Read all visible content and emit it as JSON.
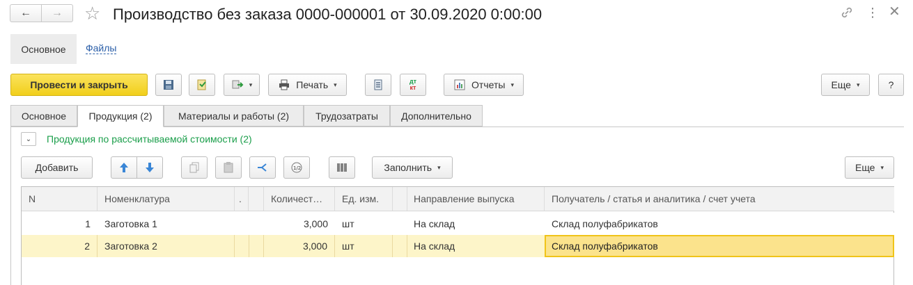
{
  "window": {
    "title": "Производство без заказа 0000-000001 от 30.09.2020 0:00:00"
  },
  "nav_tabs": [
    {
      "label": "Основное"
    },
    {
      "label": "Файлы"
    }
  ],
  "toolbar": {
    "post_close_label": "Провести и закрыть",
    "print_label": "Печать",
    "reports_label": "Отчеты",
    "more_label": "Еще",
    "help_label": "?",
    "dtkt_top": "дт",
    "dtkt_bottom": "кт"
  },
  "tabs": [
    {
      "label": "Основное"
    },
    {
      "label": "Продукция (2)"
    },
    {
      "label": "Материалы и работы (2)"
    },
    {
      "label": "Трудозатраты"
    },
    {
      "label": "Дополнительно"
    }
  ],
  "section": {
    "title": "Продукция по рассчитываемой стоимости (2)"
  },
  "table_toolbar": {
    "add_label": "Добавить",
    "fill_label": "Заполнить",
    "more_label": "Еще"
  },
  "table": {
    "columns": [
      "N",
      "Номенклатура",
      ".",
      "Количест…",
      "Ед. изм.",
      "Направление выпуска",
      "Получатель / статья и аналитика / счет учета"
    ],
    "rows": [
      {
        "n": "1",
        "item": "Заготовка 1",
        "qty": "3,000",
        "unit": "шт",
        "direction": "На склад",
        "recipient": "Склад полуфабрикатов"
      },
      {
        "n": "2",
        "item": "Заготовка 2",
        "qty": "3,000",
        "unit": "шт",
        "direction": "На склад",
        "recipient": "Склад полуфабрикатов"
      }
    ]
  },
  "colors": {
    "accent_yellow": "#f6d735",
    "selected_row": "#fdf5c9",
    "selected_cell": "#fbe38c",
    "link_green": "#1a9e4a",
    "link_blue": "#2a5ea8"
  }
}
